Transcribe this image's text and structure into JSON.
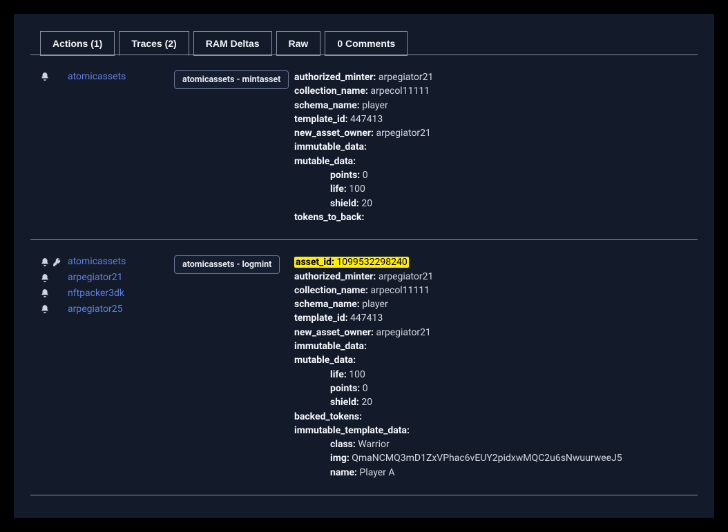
{
  "tabs": {
    "actions": "Actions (1)",
    "traces": "Traces (2)",
    "ram": "RAM Deltas",
    "raw": "Raw",
    "comments": "0 Comments"
  },
  "traces": [
    {
      "accounts": [
        {
          "name": "atomicassets",
          "icons": [
            "bell"
          ]
        }
      ],
      "pill": "atomicassets - mintasset",
      "rows": [
        {
          "key": "authorized_minter:",
          "val": "arpegiator21",
          "indent": false
        },
        {
          "key": "collection_name:",
          "val": "arpecol11111",
          "indent": false
        },
        {
          "key": "schema_name:",
          "val": "player",
          "indent": false
        },
        {
          "key": "template_id:",
          "val": "447413",
          "indent": false
        },
        {
          "key": "new_asset_owner:",
          "val": "arpegiator21",
          "indent": false
        },
        {
          "key": "immutable_data:",
          "val": "",
          "indent": false
        },
        {
          "key": "mutable_data:",
          "val": "",
          "indent": false
        },
        {
          "key": "points:",
          "val": "0",
          "indent": true
        },
        {
          "key": "life:",
          "val": "100",
          "indent": true
        },
        {
          "key": "shield:",
          "val": "20",
          "indent": true
        },
        {
          "key": "tokens_to_back:",
          "val": "",
          "indent": false
        }
      ]
    },
    {
      "accounts": [
        {
          "name": "atomicassets",
          "icons": [
            "bell",
            "key"
          ]
        },
        {
          "name": "arpegiator21",
          "icons": [
            "bell"
          ]
        },
        {
          "name": "nftpacker3dk",
          "icons": [
            "bell"
          ]
        },
        {
          "name": "arpegiator25",
          "icons": [
            "bell"
          ]
        }
      ],
      "pill": "atomicassets - logmint",
      "rows": [
        {
          "key": "asset_id:",
          "val": "1099532298240",
          "indent": false,
          "highlight": true
        },
        {
          "key": "authorized_minter:",
          "val": "arpegiator21",
          "indent": false
        },
        {
          "key": "collection_name:",
          "val": "arpecol11111",
          "indent": false
        },
        {
          "key": "schema_name:",
          "val": "player",
          "indent": false
        },
        {
          "key": "template_id:",
          "val": "447413",
          "indent": false
        },
        {
          "key": "new_asset_owner:",
          "val": "arpegiator21",
          "indent": false
        },
        {
          "key": "immutable_data:",
          "val": "",
          "indent": false
        },
        {
          "key": "mutable_data:",
          "val": "",
          "indent": false
        },
        {
          "key": "life:",
          "val": "100",
          "indent": true
        },
        {
          "key": "points:",
          "val": "0",
          "indent": true
        },
        {
          "key": "shield:",
          "val": "20",
          "indent": true
        },
        {
          "key": "backed_tokens:",
          "val": "",
          "indent": false
        },
        {
          "key": "immutable_template_data:",
          "val": "",
          "indent": false
        },
        {
          "key": "class:",
          "val": "Warrior",
          "indent": true
        },
        {
          "key": "img:",
          "val": "QmaNCMQ3mD1ZxVPhac6vEUY2pidxwMQC2u6sNwuurweeJ5",
          "indent": true
        },
        {
          "key": "name:",
          "val": "Player A",
          "indent": true
        }
      ]
    }
  ]
}
